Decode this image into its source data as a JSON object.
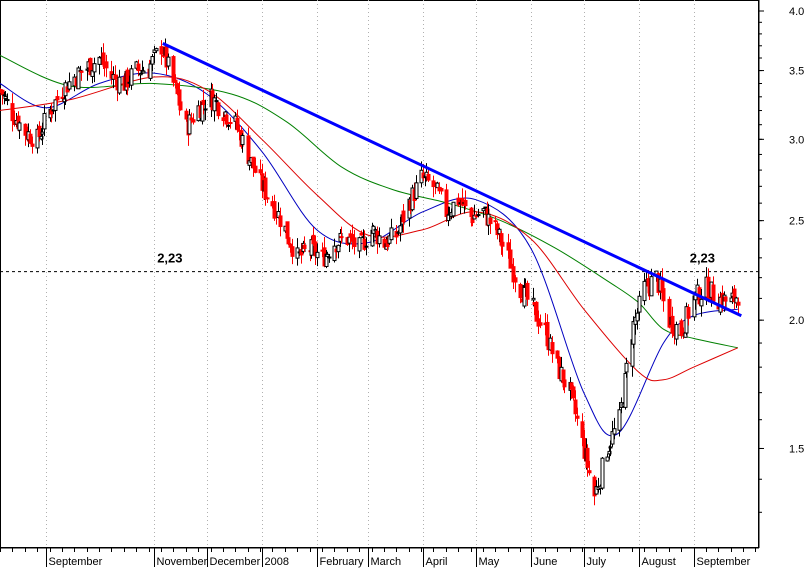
{
  "chart_data": {
    "type": "candlestick",
    "scale": "log",
    "ylim": [
      1.2,
      4.1
    ],
    "y_ticks": [
      "4.0",
      "3.5",
      "3.0",
      "2.5",
      "2.0",
      "1.5"
    ],
    "y_tick_values": [
      4.0,
      3.5,
      3.0,
      2.5,
      2.0,
      1.5
    ],
    "x_labels": [
      "September",
      "November",
      "December",
      "2008",
      "February",
      "March",
      "April",
      "May",
      "June",
      "July",
      "August",
      "September"
    ],
    "x_label_dates": [
      "2007-09-01",
      "2007-11-01",
      "2007-12-01",
      "2008-01-01",
      "2008-02-01",
      "2008-03-01",
      "2008-04-01",
      "2008-05-01",
      "2008-06-01",
      "2008-07-01",
      "2008-08-01",
      "2008-09-01"
    ],
    "x_range": [
      "2007-08-06",
      "2008-10-08"
    ],
    "grid": "vertical dotted at month starts",
    "colors": {
      "up": "#000000",
      "down": "#ff0000",
      "ma_short": "#0000c0",
      "ma_mid": "#008000",
      "ma_long": "#dd0000",
      "trendline": "#0000ff",
      "support": "#000000"
    },
    "price_path": [
      [
        "2007-08-06",
        3.35
      ],
      [
        "2007-08-13",
        3.18
      ],
      [
        "2007-08-20",
        3.05
      ],
      [
        "2007-08-27",
        3.0
      ],
      [
        "2007-09-03",
        3.2
      ],
      [
        "2007-09-10",
        3.35
      ],
      [
        "2007-09-17",
        3.45
      ],
      [
        "2007-09-24",
        3.52
      ],
      [
        "2007-10-01",
        3.6
      ],
      [
        "2007-10-08",
        3.45
      ],
      [
        "2007-10-15",
        3.4
      ],
      [
        "2007-10-22",
        3.5
      ],
      [
        "2007-10-29",
        3.52
      ],
      [
        "2007-11-05",
        3.7
      ],
      [
        "2007-11-12",
        3.4
      ],
      [
        "2007-11-19",
        3.08
      ],
      [
        "2007-11-26",
        3.22
      ],
      [
        "2007-12-03",
        3.3
      ],
      [
        "2007-12-10",
        3.2
      ],
      [
        "2007-12-17",
        3.1
      ],
      [
        "2007-12-24",
        2.9
      ],
      [
        "2007-12-31",
        2.72
      ],
      [
        "2008-01-07",
        2.6
      ],
      [
        "2008-01-14",
        2.45
      ],
      [
        "2008-01-21",
        2.3
      ],
      [
        "2008-01-28",
        2.35
      ],
      [
        "2008-02-04",
        2.3
      ],
      [
        "2008-02-11",
        2.38
      ],
      [
        "2008-02-18",
        2.4
      ],
      [
        "2008-02-25",
        2.35
      ],
      [
        "2008-03-03",
        2.45
      ],
      [
        "2008-03-10",
        2.38
      ],
      [
        "2008-03-17",
        2.42
      ],
      [
        "2008-03-24",
        2.6
      ],
      [
        "2008-03-31",
        2.75
      ],
      [
        "2008-04-07",
        2.7
      ],
      [
        "2008-04-14",
        2.55
      ],
      [
        "2008-04-21",
        2.62
      ],
      [
        "2008-04-28",
        2.52
      ],
      [
        "2008-05-05",
        2.55
      ],
      [
        "2008-05-12",
        2.45
      ],
      [
        "2008-05-19",
        2.3
      ],
      [
        "2008-05-26",
        2.15
      ],
      [
        "2008-06-02",
        2.05
      ],
      [
        "2008-06-09",
        1.95
      ],
      [
        "2008-06-16",
        1.8
      ],
      [
        "2008-06-23",
        1.7
      ],
      [
        "2008-06-30",
        1.52
      ],
      [
        "2008-07-07",
        1.35
      ],
      [
        "2008-07-14",
        1.5
      ],
      [
        "2008-07-21",
        1.6
      ],
      [
        "2008-07-28",
        1.95
      ],
      [
        "2008-08-04",
        2.15
      ],
      [
        "2008-08-11",
        2.2
      ],
      [
        "2008-08-18",
        2.0
      ],
      [
        "2008-08-25",
        1.95
      ],
      [
        "2008-09-01",
        2.1
      ],
      [
        "2008-09-08",
        2.15
      ],
      [
        "2008-09-15",
        2.1
      ],
      [
        "2008-09-22",
        2.08
      ],
      [
        "2008-09-26",
        2.12
      ]
    ],
    "moving_averages": [
      {
        "color": "#0000c0",
        "points": [
          [
            "2007-08-06",
            3.4
          ],
          [
            "2007-09-01",
            3.22
          ],
          [
            "2007-10-01",
            3.4
          ],
          [
            "2007-11-01",
            3.48
          ],
          [
            "2007-12-01",
            3.32
          ],
          [
            "2008-01-01",
            2.92
          ],
          [
            "2008-02-01",
            2.45
          ],
          [
            "2008-03-01",
            2.38
          ],
          [
            "2008-04-01",
            2.55
          ],
          [
            "2008-05-01",
            2.62
          ],
          [
            "2008-06-01",
            2.35
          ],
          [
            "2008-07-01",
            1.7
          ],
          [
            "2008-07-20",
            1.55
          ],
          [
            "2008-08-15",
            1.9
          ],
          [
            "2008-09-01",
            2.02
          ],
          [
            "2008-09-26",
            2.05
          ]
        ]
      },
      {
        "color": "#008000",
        "points": [
          [
            "2007-08-06",
            3.62
          ],
          [
            "2007-09-15",
            3.38
          ],
          [
            "2007-11-01",
            3.4
          ],
          [
            "2007-12-15",
            3.32
          ],
          [
            "2008-01-15",
            3.12
          ],
          [
            "2008-02-15",
            2.82
          ],
          [
            "2008-03-15",
            2.68
          ],
          [
            "2008-04-15",
            2.6
          ],
          [
            "2008-05-15",
            2.5
          ],
          [
            "2008-06-15",
            2.35
          ],
          [
            "2008-07-15",
            2.18
          ],
          [
            "2008-08-01",
            2.08
          ],
          [
            "2008-08-15",
            1.96
          ],
          [
            "2008-09-01",
            1.92
          ],
          [
            "2008-09-26",
            1.88
          ]
        ]
      },
      {
        "color": "#dd0000",
        "points": [
          [
            "2007-08-06",
            3.2
          ],
          [
            "2007-09-15",
            3.28
          ],
          [
            "2007-11-01",
            3.45
          ],
          [
            "2007-12-01",
            3.35
          ],
          [
            "2008-01-01",
            3.0
          ],
          [
            "2008-02-01",
            2.65
          ],
          [
            "2008-03-01",
            2.42
          ],
          [
            "2008-04-01",
            2.45
          ],
          [
            "2008-05-01",
            2.55
          ],
          [
            "2008-06-01",
            2.4
          ],
          [
            "2008-07-01",
            2.05
          ],
          [
            "2008-08-01",
            1.78
          ],
          [
            "2008-08-15",
            1.75
          ],
          [
            "2008-09-01",
            1.8
          ],
          [
            "2008-09-26",
            1.88
          ]
        ]
      }
    ],
    "trendline": {
      "from": [
        "2007-11-06",
        3.72
      ],
      "to": [
        "2008-09-28",
        2.02
      ]
    },
    "support_level": 2.23,
    "annotations": [
      {
        "text": "2,23",
        "date": "2007-11-10",
        "value": 2.23
      },
      {
        "text": "2,23",
        "date": "2008-09-06",
        "value": 2.23
      }
    ]
  }
}
